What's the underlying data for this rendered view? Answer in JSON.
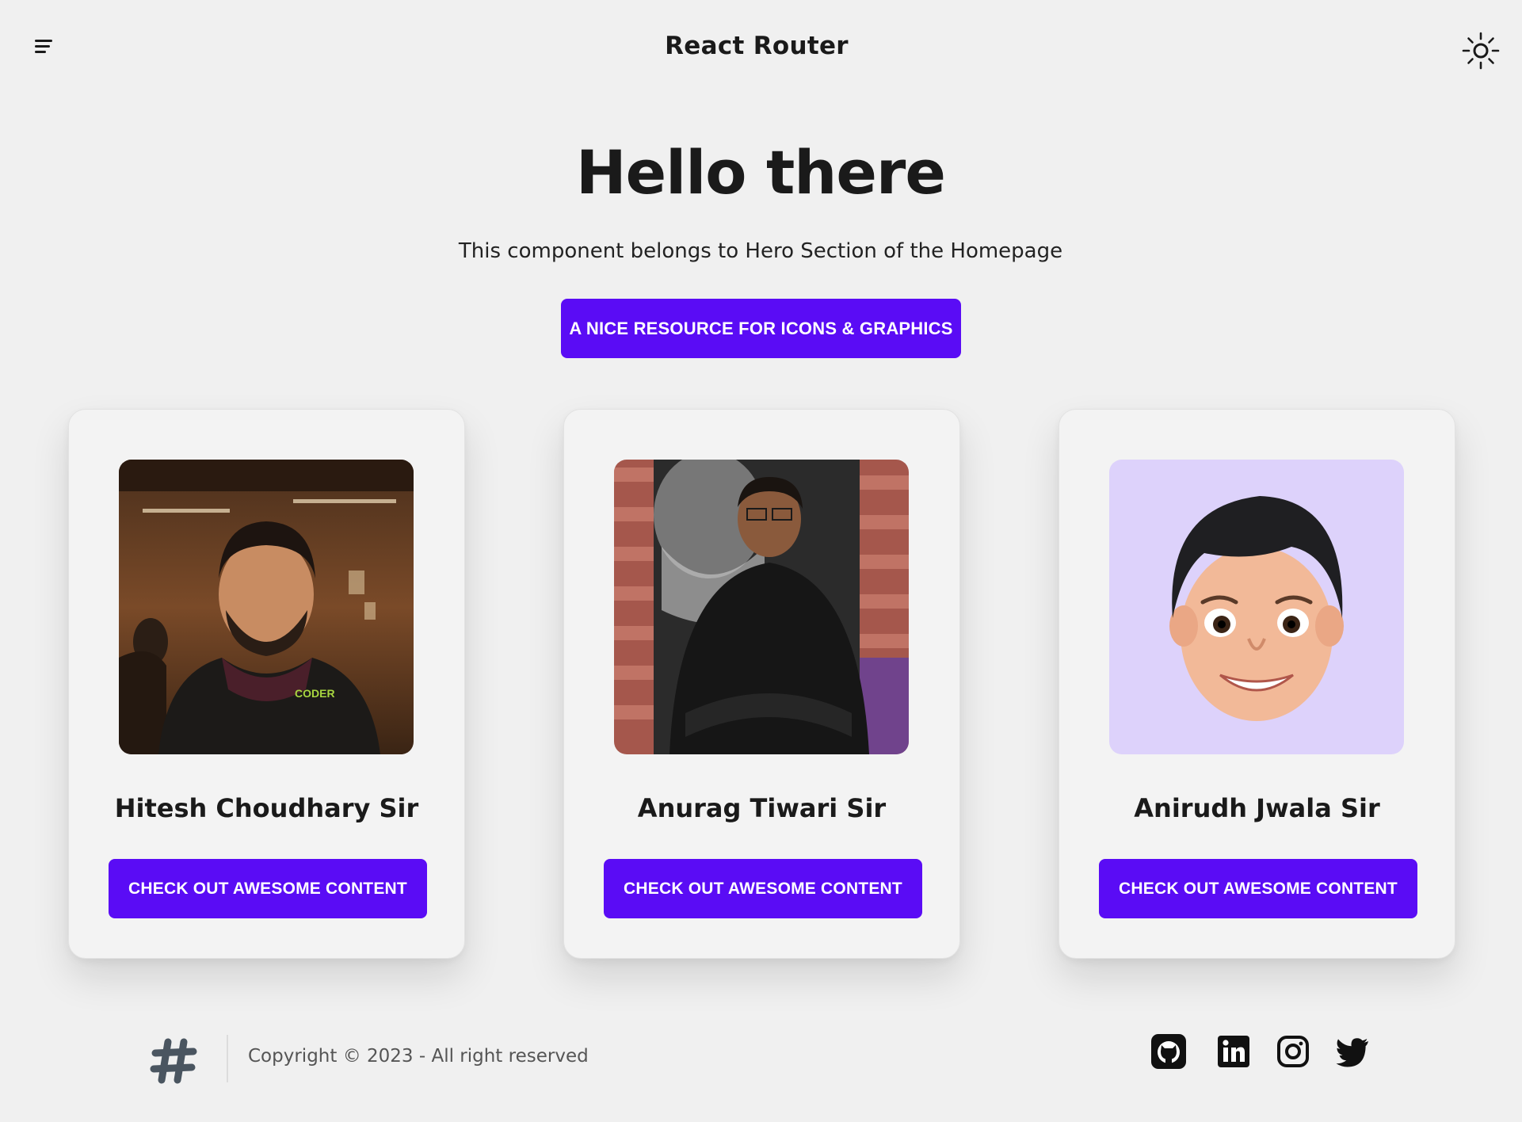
{
  "navbar": {
    "brand": "React Router",
    "menu_icon": "menu-icon",
    "theme_icon": "sun-icon"
  },
  "hero": {
    "title": "Hello there",
    "subtitle": "This component belongs to Hero Section of the Homepage",
    "cta_label": "A NICE RESOURCE FOR ICONS & GRAPHICS"
  },
  "cards": [
    {
      "name": "Hitesh Choudhary Sir",
      "button_label": "CHECK OUT AWESOME CONTENT",
      "photo": "person-photo",
      "photo_text": "CODER"
    },
    {
      "name": "Anurag Tiwari Sir",
      "button_label": "CHECK OUT AWESOME CONTENT",
      "photo": "person-photo"
    },
    {
      "name": "Anirudh Jwala Sir",
      "button_label": "CHECK OUT AWESOME CONTENT",
      "photo": "memoji-avatar"
    }
  ],
  "footer": {
    "logo_icon": "slack-hash-icon",
    "copyright": "Copyright © 2023 - All right reserved",
    "social": [
      "github-icon",
      "linkedin-icon",
      "instagram-icon",
      "twitter-icon"
    ]
  },
  "colors": {
    "background": "#f0f0f0",
    "accent": "#5a0cf5",
    "card_bg": "#f3f3f3",
    "text": "#1a1a1a",
    "muted": "#555555"
  }
}
